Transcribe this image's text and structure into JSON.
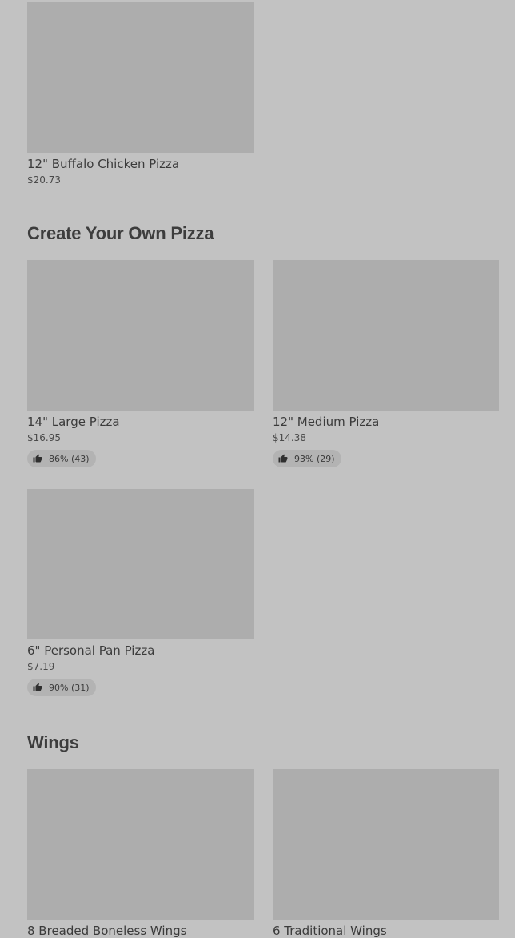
{
  "sections": [
    {
      "items": [
        {
          "name": "12\" Buffalo Chicken Pizza",
          "price": "$20.73"
        }
      ]
    },
    {
      "title": "Create Your Own Pizza",
      "items": [
        {
          "name": "14\" Large Pizza",
          "price": "$16.95",
          "rating": "86% (43)"
        },
        {
          "name": "12\" Medium Pizza",
          "price": "$14.38",
          "rating": "93% (29)"
        },
        {
          "name": "6\" Personal Pan Pizza",
          "price": "$7.19",
          "rating": "90% (31)"
        }
      ]
    },
    {
      "title": "Wings",
      "items": [
        {
          "name": "8 Breaded Boneless Wings"
        },
        {
          "name": "6 Traditional Wings"
        }
      ]
    }
  ],
  "icons": {
    "rating_icon": "thumbs-up-icon"
  },
  "colors": {
    "background": "#c2c2c2",
    "image_placeholder": "#adadad",
    "rating_pill": "#b3b3b3",
    "text": "#3b3b3b"
  }
}
